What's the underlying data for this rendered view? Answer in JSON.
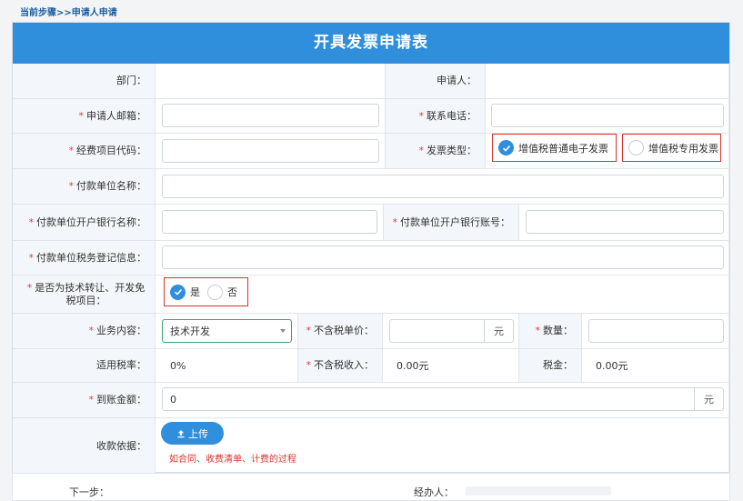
{
  "breadcrumb": "当前步骤>>申请人申请",
  "form_title": "开具发票申请表",
  "labels": {
    "department": "部门：",
    "applicant": "申请人：",
    "email": "申请人邮箱：",
    "phone": "联系电话：",
    "project_code": "经费项目代码：",
    "invoice_type": "发票类型：",
    "payer_name": "付款单位名称：",
    "payer_bank": "付款单位开户银行名称：",
    "payer_account": "付款单位开户银行账号：",
    "payer_tax": "付款单位税务登记信息：",
    "tech_transfer": "是否为技术转让、开发免税项目：",
    "business": "业务内容：",
    "unit_price": "不含税单价：",
    "quantity": "数量：",
    "tax_rate": "适用税率：",
    "income": "不含税收入：",
    "tax": "税金：",
    "amount": "到账金额：",
    "basis": "收款依据："
  },
  "required_mark": "*",
  "invoice_types": {
    "option1": "增值税普通电子发票",
    "option2": "增值税专用发票",
    "selected": "option1"
  },
  "tech_transfer_options": {
    "yes": "是",
    "no": "否",
    "selected": "yes"
  },
  "business_select": {
    "value": "技术开发"
  },
  "unit_suffix": "元",
  "values": {
    "tax_rate": "0%",
    "income": "0.00元",
    "tax": "0.00元",
    "amount": "0"
  },
  "upload_label": "上传",
  "basis_hint": "如合同、收费清单、计费的过程",
  "footer": {
    "next_step": "下一步：",
    "handler": "经办人："
  },
  "icons": {
    "check": "check-icon",
    "upload": "upload-icon",
    "caret": "caret-down-icon"
  },
  "colors": {
    "primary": "#2f8fdd",
    "required": "#e23b3b",
    "highlight_border": "#d9342b"
  }
}
